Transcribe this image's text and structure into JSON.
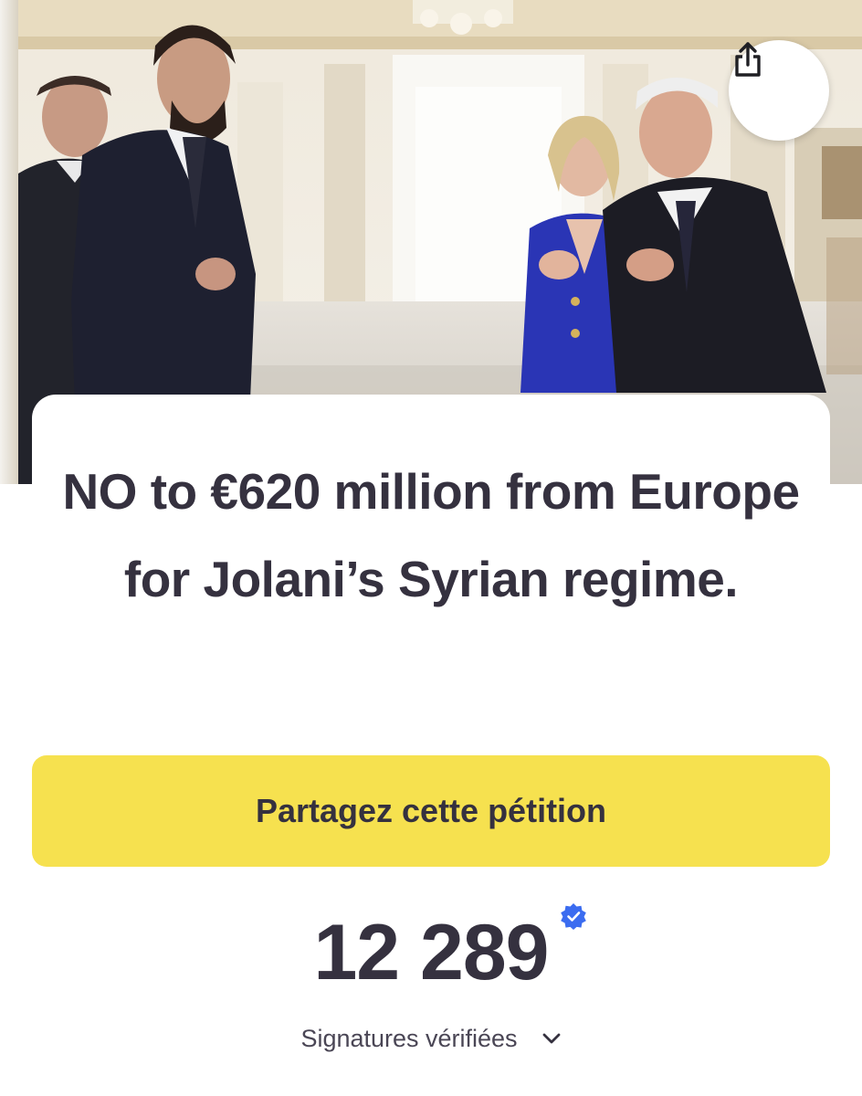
{
  "hero": {
    "image_description_icon": "photo-four-people-meeting"
  },
  "share_icon": "share-icon",
  "petition": {
    "title": "NO to €620 million from Europe for Jolani’s Syrian regime.",
    "share_button_label": "Partagez cette pétition",
    "signature_count": "12 289",
    "signatures_label": "Signatures vérifiées",
    "verified_icon": "verified-badge-icon",
    "expand_icon": "chevron-down-icon"
  },
  "colors": {
    "share_button_bg": "#f6e14f",
    "text": "#35313f",
    "verified_badge": "#3b6cf0"
  }
}
